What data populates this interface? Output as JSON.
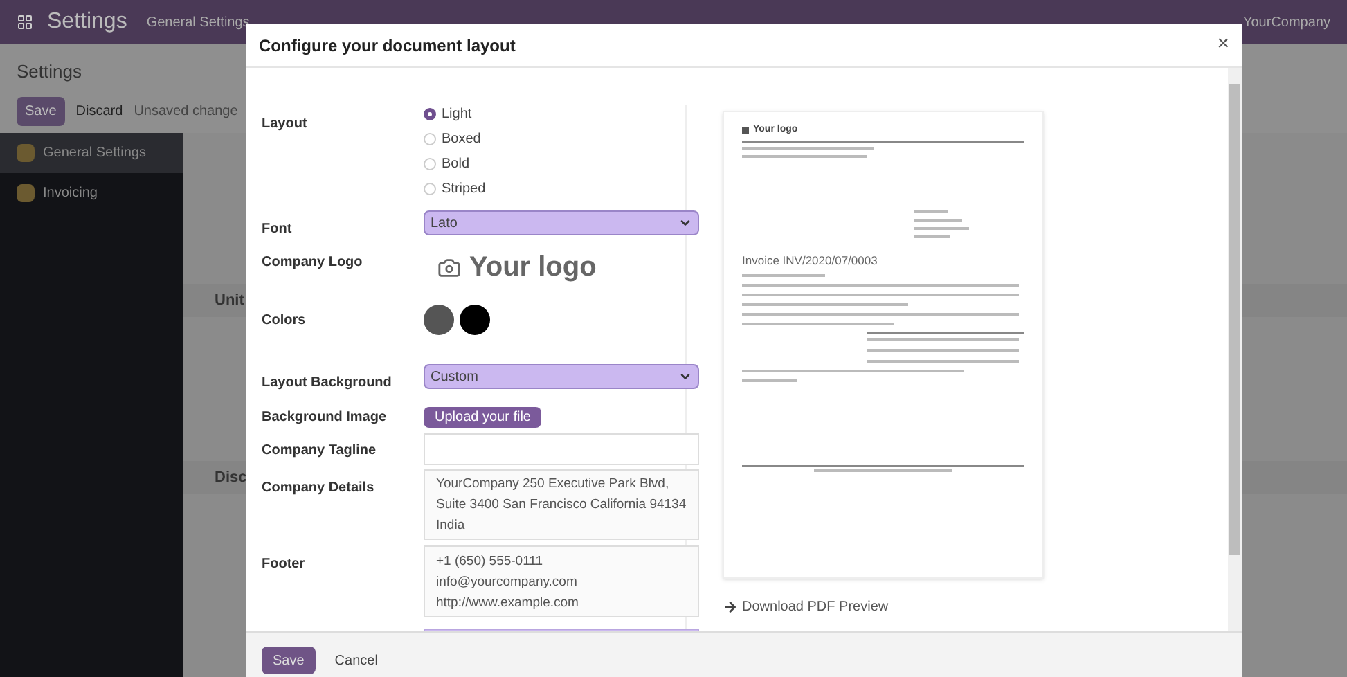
{
  "topbar": {
    "app_title": "Settings",
    "breadcrumb": "General Settings",
    "company": "YourCompany"
  },
  "page": {
    "title": "Settings",
    "save": "Save",
    "discard": "Discard",
    "unsaved": "Unsaved change",
    "sections": [
      "Unit",
      "Disc"
    ]
  },
  "sidebar": {
    "items": [
      {
        "label": "General Settings",
        "selected": true
      },
      {
        "label": "Invoicing",
        "selected": false
      }
    ]
  },
  "dialog": {
    "title": "Configure your document layout",
    "close": "×",
    "layout": {
      "label": "Layout",
      "options": [
        {
          "label": "Light",
          "selected": true
        },
        {
          "label": "Boxed",
          "selected": false
        },
        {
          "label": "Bold",
          "selected": false
        },
        {
          "label": "Striped",
          "selected": false
        }
      ]
    },
    "font": {
      "label": "Font",
      "value": "Lato"
    },
    "logo": {
      "label": "Company Logo",
      "text": "Your logo"
    },
    "colors": {
      "label": "Colors",
      "swatches": [
        {
          "color": "#555555"
        },
        {
          "color": "#000000"
        }
      ]
    },
    "layout_background": {
      "label": "Layout Background",
      "value": "Custom"
    },
    "background_image": {
      "label": "Background Image",
      "button": "Upload your file"
    },
    "tagline": {
      "label": "Company Tagline"
    },
    "details": {
      "label": "Company Details",
      "lines": [
        "YourCompany 250 Executive Park Blvd,",
        "Suite 3400 San Francisco California 94134",
        "India"
      ]
    },
    "footer": {
      "label": "Footer",
      "lines": [
        "+1 (650) 555-0111",
        "info@yourcompany.com",
        "http://www.example.com"
      ]
    },
    "preview": {
      "logo": "Your logo",
      "invoice_title": "Invoice INV/2020/07/0003"
    },
    "download": "Download PDF Preview",
    "buttons": [
      "Save",
      "Cancel"
    ]
  }
}
